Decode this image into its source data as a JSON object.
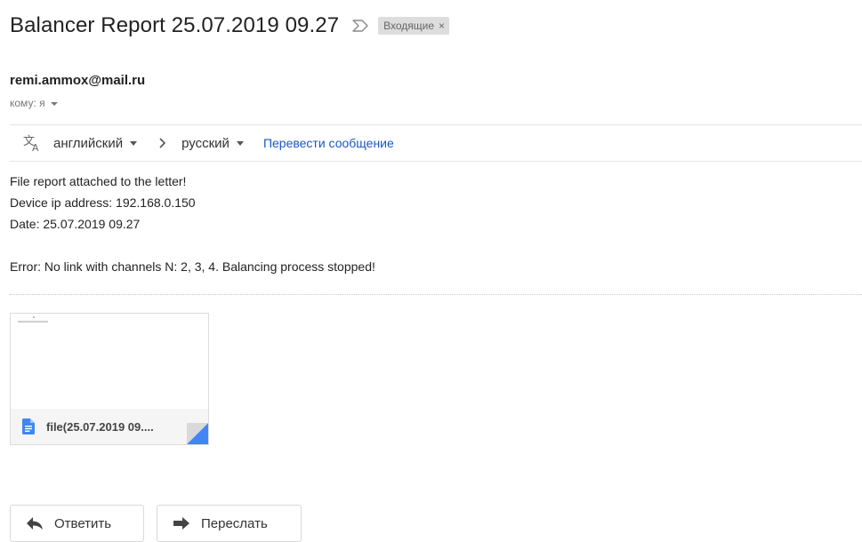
{
  "message": {
    "subject": "Balancer Report 25.07.2019 09.27",
    "label": {
      "text": "Входящие",
      "close": "×"
    },
    "sender": "remi.ammox@mail.ru",
    "recipients": "кому: я"
  },
  "translate": {
    "from_lang": "английский",
    "to_lang": "русский",
    "action": "Перевести сообщение"
  },
  "body": {
    "lines": [
      "File report attached to the letter!",
      "Device ip address: 192.168.0.150",
      "Date: 25.07.2019 09.27"
    ],
    "error": "Error: No link with channels N: 2, 3, 4. Balancing process stopped!"
  },
  "attachment": {
    "filename": "file(25.07.2019 09....",
    "icon": "google-docs-icon"
  },
  "actions": {
    "reply": "Ответить",
    "forward": "Переслать"
  },
  "colors": {
    "link": "#1a56c4",
    "doc_icon": "#4285f4",
    "label_bg": "#dddddd"
  }
}
